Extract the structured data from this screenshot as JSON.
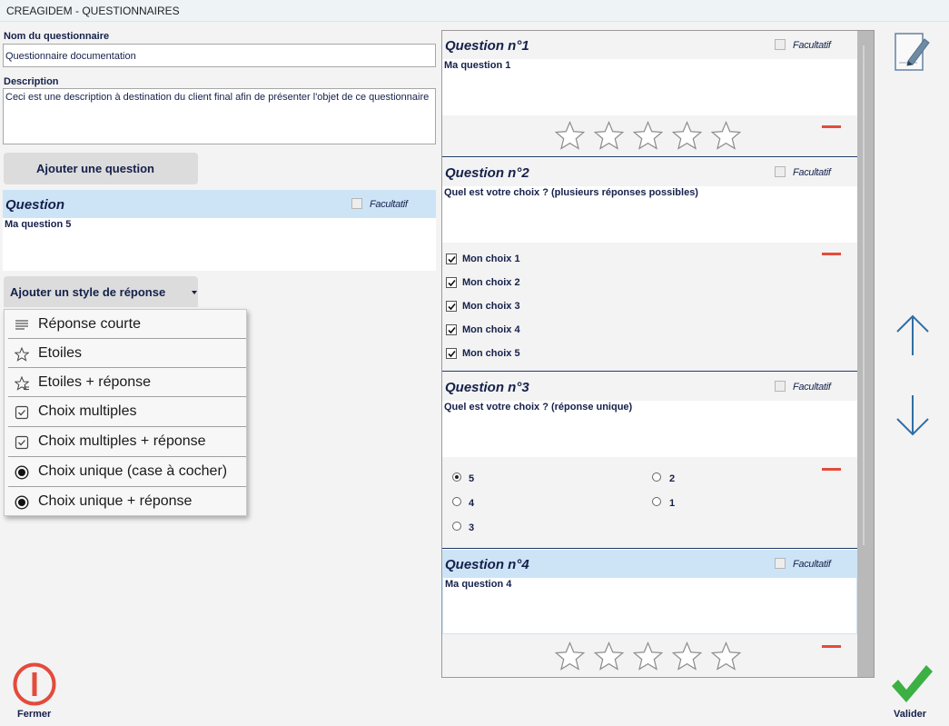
{
  "window": {
    "title": "CREAGIDEM - QUESTIONNAIRES"
  },
  "form": {
    "name_label": "Nom du questionnaire",
    "name_value": "Questionnaire documentation",
    "description_label": "Description",
    "description_value": "Ceci est une description à destination du client final afin de présenter l'objet de ce questionnaire",
    "add_question_label": "Ajouter une question"
  },
  "editor": {
    "title": "Question",
    "optional_label": "Facultatif",
    "question_text": "Ma question 5",
    "add_style_label": "Ajouter un style de réponse"
  },
  "response_menu": [
    {
      "label": "Réponse courte",
      "icon": "lines-icon"
    },
    {
      "label": "Etoiles",
      "icon": "star-icon"
    },
    {
      "label": "Etoiles + réponse",
      "icon": "star-text-icon"
    },
    {
      "label": "Choix multiples",
      "icon": "checkbox-icon"
    },
    {
      "label": "Choix multiples + réponse",
      "icon": "checkbox-icon"
    },
    {
      "label": "Choix unique (case à cocher)",
      "icon": "radio-icon"
    },
    {
      "label": "Choix unique + réponse",
      "icon": "radio-icon"
    }
  ],
  "questions": [
    {
      "title": "Question n°1",
      "optional_label": "Facultatif",
      "text": "Ma question  1",
      "type": "stars",
      "stars": 5
    },
    {
      "title": "Question n°2",
      "optional_label": "Facultatif",
      "text": "Quel est votre choix ? (plusieurs réponses possibles)",
      "type": "multiple",
      "choices": [
        "Mon choix 1",
        "Mon choix 2",
        "Mon choix 3",
        "Mon choix 4",
        "Mon choix 5"
      ]
    },
    {
      "title": "Question n°3",
      "optional_label": "Facultatif",
      "text": "Quel est votre choix ? (réponse unique)",
      "type": "single",
      "options": [
        "5",
        "2",
        "4",
        "1",
        "3"
      ],
      "selected": "5"
    },
    {
      "title": "Question n°4",
      "optional_label": "Facultatif",
      "text": "Ma question 4",
      "type": "stars",
      "stars": 5
    }
  ],
  "actions": {
    "close_label": "Fermer",
    "validate_label": "Valider"
  },
  "colors": {
    "accent_text": "#15204a",
    "header_highlight": "#cde4f7",
    "remove": "#e34b3c",
    "validate": "#3cb043",
    "close": "#e34b3c"
  }
}
